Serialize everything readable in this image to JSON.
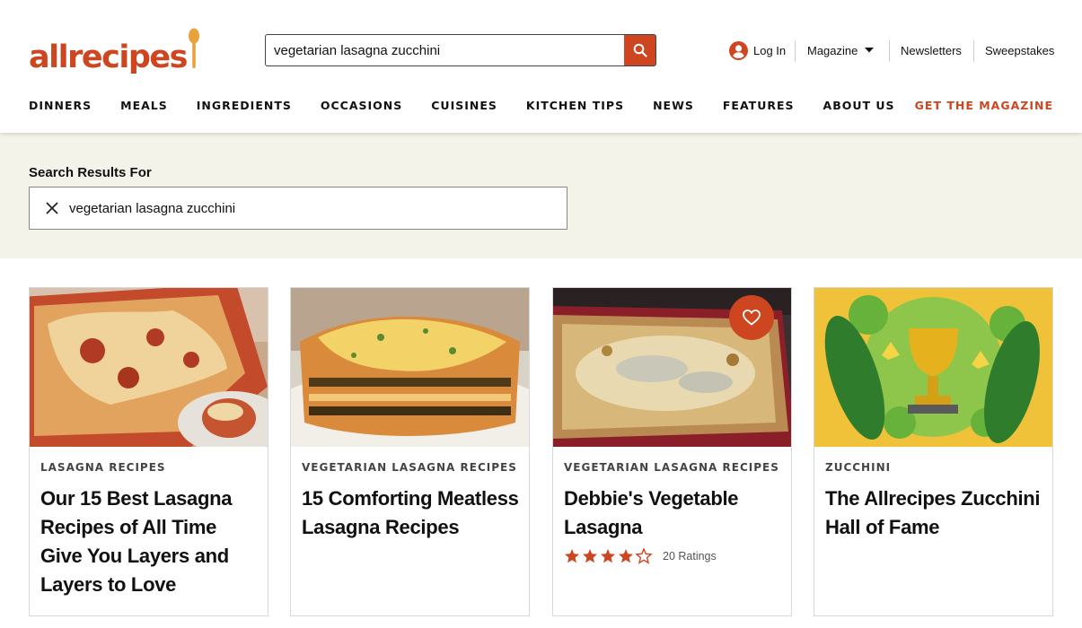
{
  "header": {
    "logo_text": "allrecipes",
    "search": {
      "value": "vegetarian lasagna zucchini",
      "placeholder": ""
    },
    "login_label": "Log In",
    "magazine_label": "Magazine",
    "newsletters_label": "Newsletters",
    "sweepstakes_label": "Sweepstakes",
    "brand_color": "#ce4620"
  },
  "nav": {
    "items": [
      "DINNERS",
      "MEALS",
      "INGREDIENTS",
      "OCCASIONS",
      "CUISINES",
      "KITCHEN TIPS",
      "NEWS",
      "FEATURES",
      "ABOUT US"
    ],
    "cta": "GET THE MAGAZINE"
  },
  "results": {
    "label": "Search Results For",
    "query": "vegetarian lasagna zucchini"
  },
  "cards": [
    {
      "tag": "LASAGNA RECIPES",
      "title": "Our 15 Best Lasagna Recipes of All Time Give You Layers and Layers to Love",
      "image": "baked-lasagna-photo"
    },
    {
      "tag": "VEGETARIAN LASAGNA RECIPES",
      "title": "15 Comforting Meatless Lasagna Recipes",
      "image": "meatless-lasagna-slice-photo"
    },
    {
      "tag": "VEGETARIAN LASAGNA RECIPES",
      "title": "Debbie's Vegetable Lasagna",
      "image": "vegetable-lasagna-dish-photo",
      "rating": 4.5,
      "ratings_count": "20 Ratings",
      "saved_icon": "heart-icon"
    },
    {
      "tag": "ZUCCHINI",
      "title": "The Allrecipes Zucchini Hall of Fame",
      "image": "zucchini-trophy-illustration"
    }
  ]
}
